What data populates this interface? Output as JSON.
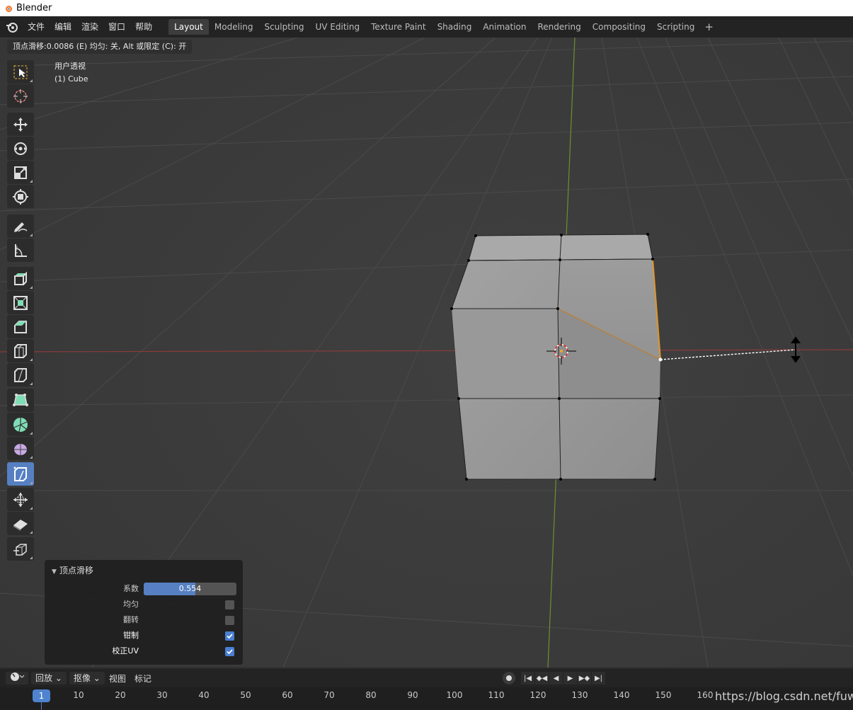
{
  "window": {
    "title": "Blender"
  },
  "menu": {
    "items": [
      "文件",
      "编辑",
      "渲染",
      "窗口",
      "帮助"
    ]
  },
  "workspaces": {
    "tabs": [
      "Layout",
      "Modeling",
      "Sculpting",
      "UV Editing",
      "Texture Paint",
      "Shading",
      "Animation",
      "Rendering",
      "Compositing",
      "Scripting"
    ],
    "active": "Layout",
    "add_label": "+"
  },
  "viewport": {
    "status": "顶点滑移:0.0086 (E) 均匀: 关, Alt 或限定 (C): 开",
    "view_name": "用户透视",
    "object_name": "(1) Cube"
  },
  "tools": [
    {
      "icon": "select-box-icon",
      "active": false
    },
    {
      "icon": "cursor-icon",
      "active": false
    },
    {
      "icon": "move-icon",
      "active": false
    },
    {
      "icon": "rotate-icon",
      "active": false
    },
    {
      "icon": "scale-icon",
      "active": false
    },
    {
      "icon": "transform-icon",
      "active": false
    },
    {
      "icon": "annotate-icon",
      "active": false
    },
    {
      "icon": "measure-icon",
      "active": false
    },
    {
      "icon": "extrude-region-icon",
      "active": false
    },
    {
      "icon": "inset-faces-icon",
      "active": false
    },
    {
      "icon": "bevel-icon",
      "active": false
    },
    {
      "icon": "loop-cut-icon",
      "active": false
    },
    {
      "icon": "knife-icon",
      "active": false
    },
    {
      "icon": "poly-build-icon",
      "active": false
    },
    {
      "icon": "spin-icon",
      "active": false
    },
    {
      "icon": "smooth-icon",
      "active": false
    },
    {
      "icon": "edge-slide-icon",
      "active": true
    },
    {
      "icon": "shrink-fatten-icon",
      "active": false
    },
    {
      "icon": "shear-icon",
      "active": false
    },
    {
      "icon": "rip-region-icon",
      "active": false
    }
  ],
  "operator_panel": {
    "title": "顶点滑移",
    "factor_label": "系数",
    "factor_value": "0.554",
    "factor_fraction": 0.554,
    "options": [
      {
        "label": "均匀",
        "checked": false
      },
      {
        "label": "翻转",
        "checked": false
      },
      {
        "label": "钳制",
        "checked": true
      },
      {
        "label": "校正UV",
        "checked": true
      }
    ]
  },
  "timeline": {
    "playback_label": "回放",
    "keying_label": "抠像",
    "view_label": "视图",
    "marker_label": "标记",
    "current_frame": "1",
    "frames": [
      "10",
      "20",
      "30",
      "40",
      "50",
      "60",
      "70",
      "80",
      "90",
      "100",
      "110",
      "120",
      "130",
      "140",
      "150",
      "160"
    ]
  },
  "watermark": "https://blog.csdn.net/fuwa"
}
